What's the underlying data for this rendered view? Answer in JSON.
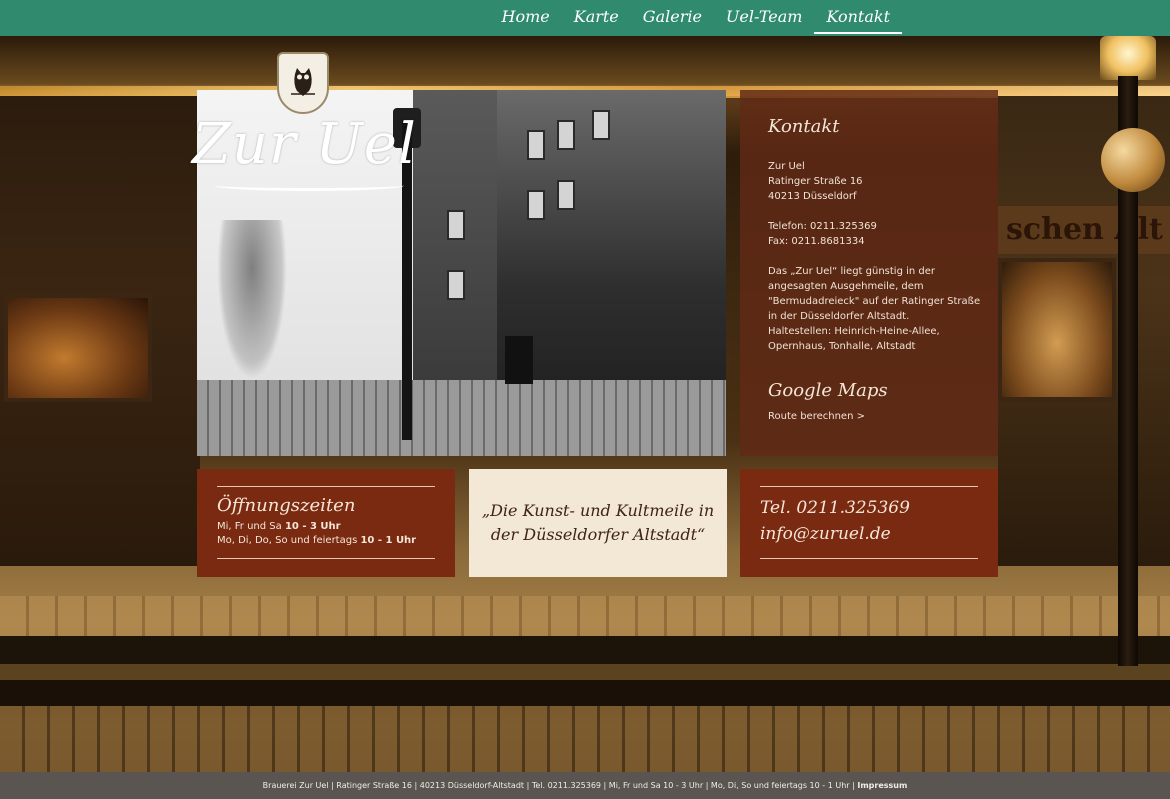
{
  "nav": {
    "items": [
      {
        "label": "Home"
      },
      {
        "label": "Karte"
      },
      {
        "label": "Galerie"
      },
      {
        "label": "Uel-Team"
      },
      {
        "label": "Kontakt"
      }
    ],
    "active": "Kontakt"
  },
  "logo": {
    "text": "Zur Uel"
  },
  "background_sign": {
    "text": "schen Alt"
  },
  "contact": {
    "title": "Kontakt",
    "name": "Zur Uel",
    "street": "Ratinger Straße 16",
    "city": "40213 Düsseldorf",
    "phone": "Telefon: 0211.325369",
    "fax": "Fax: 0211.8681334",
    "desc": [
      "Das „Zur Uel“ liegt günstig in der",
      "angesagten Ausgehmeile, dem",
      "\"Bermudadreieck\" auf der Ratinger Straße",
      "in der Düsseldorfer Altstadt.",
      "Haltestellen: Heinrich-Heine-Allee,",
      "Opernhaus, Tonhalle, Altstadt"
    ],
    "maps_title": "Google Maps",
    "route_label": "Route berechnen >"
  },
  "hours": {
    "title": "Öffnungszeiten",
    "line1_days": "Mi, Fr und Sa ",
    "line1_time": "10 - 3 Uhr",
    "line2_days": "Mo, Di, Do, So und feiertags ",
    "line2_time": "10 - 1 Uhr"
  },
  "quote": {
    "line1": "„Die Kunst- und Kultmeile in",
    "line2": "der Düsseldorfer Altstadt“"
  },
  "call": {
    "phone": "Tel. 0211.325369",
    "email": "info@zuruel.de"
  },
  "footer": {
    "text": "Brauerei Zur Uel | Ratinger Straße 16 | 40213 Düsseldorf-Altstadt | Tel. 0211.325369 | Mi, Fr und Sa 10 - 3 Uhr | Mo, Di, So und feiertags 10 - 1 Uhr | ",
    "impressum": "Impressum"
  },
  "colors": {
    "nav_bar": "#2f8a6e",
    "panel_brown": "#7a2a10",
    "quote_cream": "#f3e7d6",
    "footer": "#5a5550"
  },
  "icons": {
    "shield": "owl-shield-icon"
  }
}
